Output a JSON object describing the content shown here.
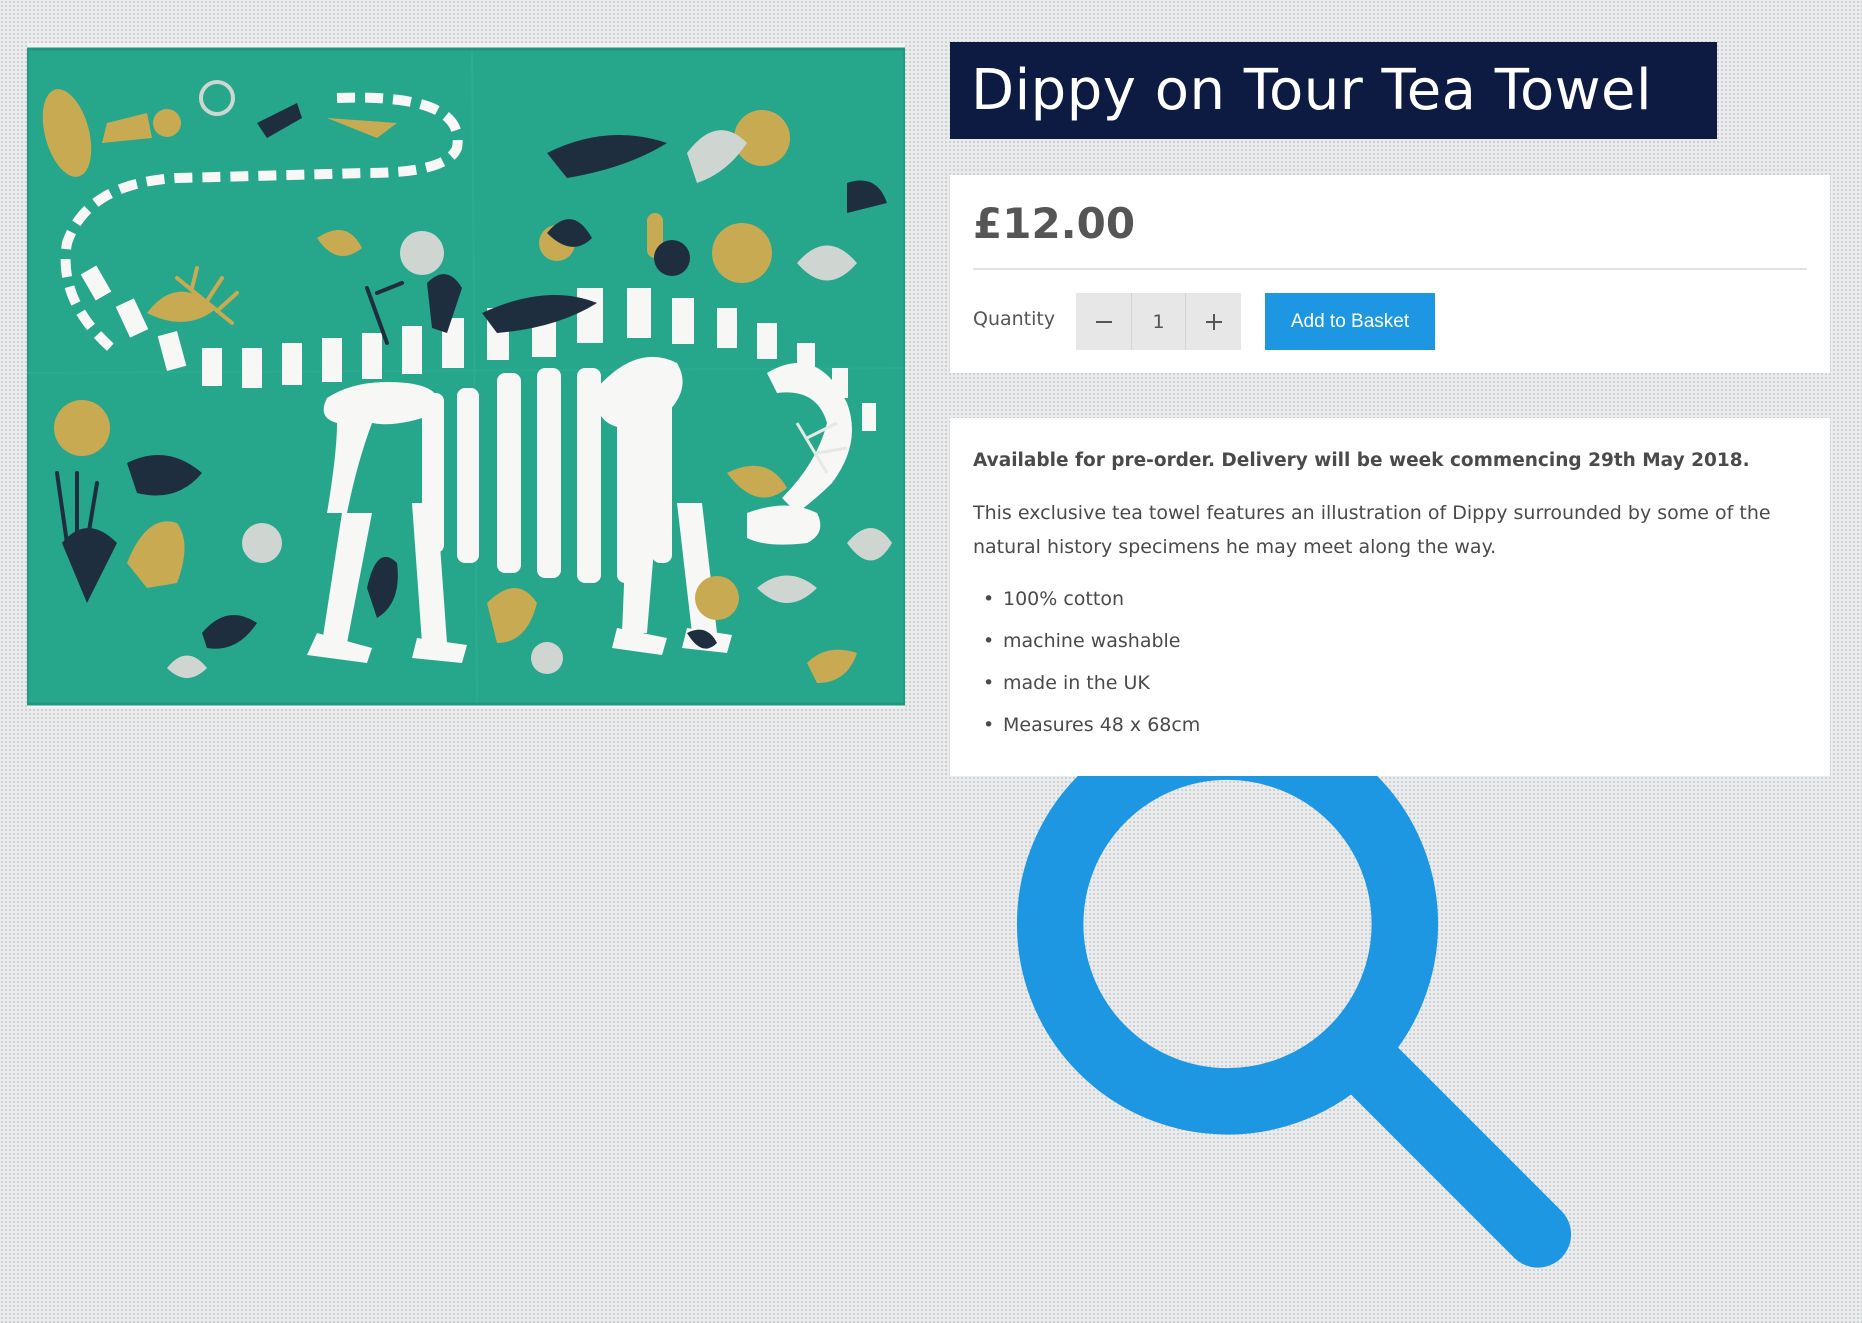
{
  "product": {
    "title": "Dippy on Tour Tea Towel",
    "image_alt": "Teal tea towel illustrated with a white Diplodocus skeleton surrounded by natural history specimens"
  },
  "purchase": {
    "price": "£12.00",
    "quantity_label": "Quantity",
    "quantity_value": "1",
    "decrease_symbol": "−",
    "increase_symbol": "+",
    "add_to_basket_label": "Add to Basket"
  },
  "description": {
    "preorder_notice": "Available for pre-order. Delivery will be week commencing 29th May 2018.",
    "intro": "This exclusive tea towel features an illustration of Dippy surrounded by some of the natural history specimens he may meet along the way.",
    "features": [
      "100% cotton",
      "machine washable",
      "made in the UK",
      "Measures 48 x 68cm"
    ]
  },
  "colors": {
    "title_background": "#0d1b43",
    "button_accent": "#1e97e3",
    "towel_teal": "#26a68b",
    "illustration_mustard": "#c8aa52",
    "illustration_navy": "#1f2e3f"
  },
  "icons": {
    "zoom": "zoom-icon",
    "minus": "minus-icon",
    "plus": "plus-icon"
  }
}
